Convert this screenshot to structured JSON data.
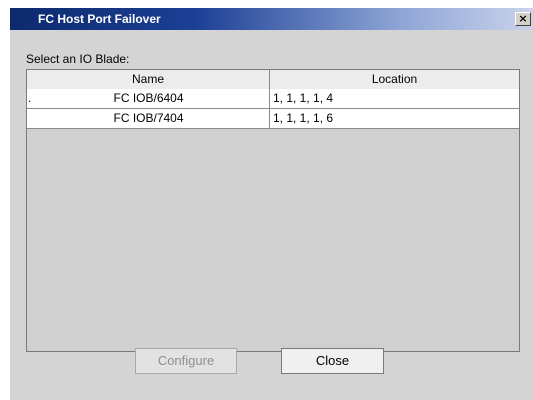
{
  "window": {
    "title": "FC Host Port Failover",
    "close_glyph": "×"
  },
  "main": {
    "select_label": "Select an IO Blade:",
    "columns": [
      "Name",
      "Location"
    ],
    "rows": [
      {
        "prefix": ".",
        "name": "FC IOB/6404",
        "location": "1, 1, 1, 1, 4"
      },
      {
        "prefix": "",
        "name": "FC IOB/7404",
        "location": "1, 1, 1, 1, 6"
      }
    ]
  },
  "buttons": {
    "configure": "Configure",
    "close": "Close"
  }
}
